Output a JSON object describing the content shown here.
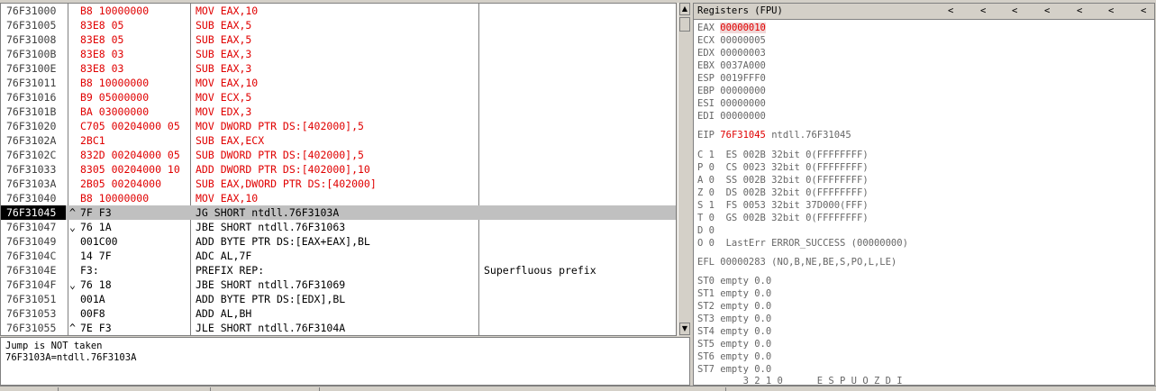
{
  "disasm": {
    "rows": [
      {
        "addr": "76F31000",
        "mark": "",
        "hex": "B8 10000000",
        "asm": "MOV EAX,10",
        "comment": "",
        "red": true
      },
      {
        "addr": "76F31005",
        "mark": "",
        "hex": "83E8 05",
        "asm": "SUB EAX,5",
        "comment": "",
        "red": true
      },
      {
        "addr": "76F31008",
        "mark": "",
        "hex": "83E8 05",
        "asm": "SUB EAX,5",
        "comment": "",
        "red": true
      },
      {
        "addr": "76F3100B",
        "mark": "",
        "hex": "83E8 03",
        "asm": "SUB EAX,3",
        "comment": "",
        "red": true
      },
      {
        "addr": "76F3100E",
        "mark": "",
        "hex": "83E8 03",
        "asm": "SUB EAX,3",
        "comment": "",
        "red": true
      },
      {
        "addr": "76F31011",
        "mark": "",
        "hex": "B8 10000000",
        "asm": "MOV EAX,10",
        "comment": "",
        "red": true
      },
      {
        "addr": "76F31016",
        "mark": "",
        "hex": "B9 05000000",
        "asm": "MOV ECX,5",
        "comment": "",
        "red": true
      },
      {
        "addr": "76F3101B",
        "mark": "",
        "hex": "BA 03000000",
        "asm": "MOV EDX,3",
        "comment": "",
        "red": true
      },
      {
        "addr": "76F31020",
        "mark": "",
        "hex": "C705 00204000 05",
        "asm": "MOV DWORD PTR DS:[402000],5",
        "comment": "",
        "red": true
      },
      {
        "addr": "76F3102A",
        "mark": "",
        "hex": "2BC1",
        "asm": "SUB EAX,ECX",
        "comment": "",
        "red": true
      },
      {
        "addr": "76F3102C",
        "mark": "",
        "hex": "832D 00204000 05",
        "asm": "SUB DWORD PTR DS:[402000],5",
        "comment": "",
        "red": true
      },
      {
        "addr": "76F31033",
        "mark": "",
        "hex": "8305 00204000 10",
        "asm": "ADD DWORD PTR DS:[402000],10",
        "comment": "",
        "red": true
      },
      {
        "addr": "76F3103A",
        "mark": "",
        "hex": "2B05 00204000",
        "asm": "SUB EAX,DWORD PTR DS:[402000]",
        "comment": "",
        "red": true
      },
      {
        "addr": "76F31040",
        "mark": "",
        "hex": "B8 10000000",
        "asm": "MOV EAX,10",
        "comment": "",
        "red": true
      },
      {
        "addr": "76F31045",
        "mark": "^",
        "hex": "7F F3",
        "asm": "JG SHORT ntdll.76F3103A",
        "comment": "",
        "red": false,
        "selected": true
      },
      {
        "addr": "76F31047",
        "mark": "⌄",
        "hex": "76 1A",
        "asm": "JBE SHORT ntdll.76F31063",
        "comment": "",
        "red": false
      },
      {
        "addr": "76F31049",
        "mark": "",
        "hex": "001C00",
        "asm": "ADD BYTE PTR DS:[EAX+EAX],BL",
        "comment": "",
        "red": false
      },
      {
        "addr": "76F3104C",
        "mark": "",
        "hex": "14 7F",
        "asm": "ADC AL,7F",
        "comment": "",
        "red": false
      },
      {
        "addr": "76F3104E",
        "mark": "",
        "hex": "F3:",
        "asm": "PREFIX REP:",
        "comment": "Superfluous prefix",
        "red": false
      },
      {
        "addr": "76F3104F",
        "mark": "⌄",
        "hex": "76 18",
        "asm": "JBE SHORT ntdll.76F31069",
        "comment": "",
        "red": false
      },
      {
        "addr": "76F31051",
        "mark": "",
        "hex": "001A",
        "asm": "ADD BYTE PTR DS:[EDX],BL",
        "comment": "",
        "red": false
      },
      {
        "addr": "76F31053",
        "mark": "",
        "hex": "00F8",
        "asm": "ADD AL,BH",
        "comment": "",
        "red": false
      },
      {
        "addr": "76F31055",
        "mark": "^",
        "hex": "7E F3",
        "asm": "JLE SHORT ntdll.76F3104A",
        "comment": "",
        "red": false
      }
    ]
  },
  "info": {
    "line1": "Jump is NOT taken",
    "line2": "76F3103A=ntdll.76F3103A"
  },
  "registers": {
    "title": "Registers (FPU)",
    "arrows": [
      "<",
      "<",
      "<",
      "<",
      "<",
      "<",
      "<"
    ],
    "general": [
      {
        "name": "EAX",
        "value": "00000010"
      },
      {
        "name": "ECX",
        "value": "00000005"
      },
      {
        "name": "EDX",
        "value": "00000003"
      },
      {
        "name": "EBX",
        "value": "0037A000"
      },
      {
        "name": "ESP",
        "value": "0019FFF0"
      },
      {
        "name": "EBP",
        "value": "00000000"
      },
      {
        "name": "ESI",
        "value": "00000000"
      },
      {
        "name": "EDI",
        "value": "00000000"
      }
    ],
    "eip": {
      "name": "EIP",
      "value": "76F31045",
      "desc": "ntdll.76F31045"
    },
    "flags": [
      "C 1  ES 002B 32bit 0(FFFFFFFF)",
      "P 0  CS 0023 32bit 0(FFFFFFFF)",
      "A 0  SS 002B 32bit 0(FFFFFFFF)",
      "Z 0  DS 002B 32bit 0(FFFFFFFF)",
      "S 1  FS 0053 32bit 37D000(FFF)",
      "T 0  GS 002B 32bit 0(FFFFFFFF)",
      "D 0",
      "O 0  LastErr ERROR_SUCCESS (00000000)"
    ],
    "efl": "EFL 00000283 (NO,B,NE,BE,S,PO,L,LE)",
    "fpu": [
      "ST0 empty 0.0",
      "ST1 empty 0.0",
      "ST2 empty 0.0",
      "ST3 empty 0.0",
      "ST4 empty 0.0",
      "ST5 empty 0.0",
      "ST6 empty 0.0",
      "ST7 empty 0.0"
    ],
    "footer": "        3 2 1 0      E S P U O Z D I"
  },
  "colors": {
    "highlight_text": "#e00000",
    "selected_addr_bg": "#000000",
    "selected_row_bg": "#c0c0c0"
  }
}
